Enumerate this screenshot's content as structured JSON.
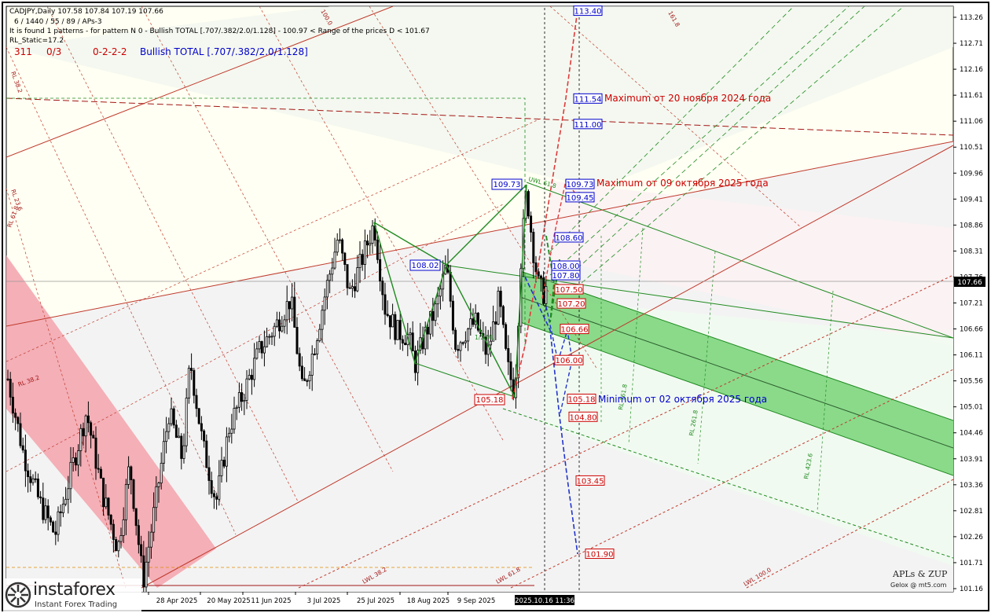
{
  "header": {
    "symbol_line": "CADJPY,Daily  107.58 107.84 107.19 107.66",
    "params_line": "6 / 1440 / 55 / 89 / APs-3",
    "found_line": "It is found 1 patterns  -  for pattern N 0 - Bullish TOTAL [.707/.382/2.0/1.128] - 100.97 < Range of the prices D < 101.67",
    "static_line": "RL_Static=17.2",
    "count_a": "311",
    "count_b": "0/3",
    "code": "0-2-2-2",
    "pattern_name": "Bullish TOTAL [.707/.382/2.0/1.128]"
  },
  "colors": {
    "red": "#cc0000",
    "blue": "#0000cc",
    "green": "#1f8a1f",
    "band_green": "#7ed67e",
    "band_pink": "#f4a7b0",
    "price_line": "#999999"
  },
  "chart_data": {
    "type": "candlestick",
    "symbol": "CADJPY",
    "timeframe": "Daily",
    "ohlc_last": {
      "open": 107.58,
      "high": 107.84,
      "low": 107.19,
      "close": 107.66
    },
    "current_price": 107.66,
    "y_ticks": [
      113.26,
      112.71,
      112.16,
      111.61,
      111.06,
      110.51,
      109.96,
      109.41,
      108.86,
      108.31,
      107.76,
      107.21,
      106.66,
      106.11,
      105.56,
      105.01,
      104.46,
      103.91,
      103.36,
      102.81,
      102.26,
      101.71,
      101.16
    ],
    "ylim": [
      101.05,
      113.5
    ],
    "x_ticks": [
      "28 Apr 2025",
      "20 May 2025",
      "11 Jun 2025",
      "3 Jul 2025",
      "25 Jul 2025",
      "18 Aug 2025",
      "9 Sep 2025"
    ],
    "cursor_time": "2025.10.16 11:36",
    "pattern_points": [
      {
        "label": "108.02",
        "price": 108.02
      },
      {
        "label": "109.73",
        "price": 109.73
      },
      {
        "label": "105.18",
        "price": 105.18
      }
    ],
    "targets": [
      {
        "label": "113.40",
        "price": 113.4,
        "color": "blue"
      },
      {
        "label": "111.54",
        "price": 111.54,
        "color": "blue"
      },
      {
        "label": "111.00",
        "price": 111.0,
        "color": "blue"
      },
      {
        "label": "109.73",
        "price": 109.73,
        "color": "blue"
      },
      {
        "label": "109.45",
        "price": 109.45,
        "color": "blue"
      },
      {
        "label": "108.60",
        "price": 108.6,
        "color": "blue"
      },
      {
        "label": "108.00",
        "price": 108.0,
        "color": "blue"
      },
      {
        "label": "107.80",
        "price": 107.8,
        "color": "blue"
      },
      {
        "label": "107.50",
        "price": 107.5,
        "color": "red"
      },
      {
        "label": "107.20",
        "price": 107.2,
        "color": "red"
      },
      {
        "label": "106.66",
        "price": 106.66,
        "color": "red"
      },
      {
        "label": "106.00",
        "price": 106.0,
        "color": "red"
      },
      {
        "label": "105.18",
        "price": 105.18,
        "color": "red"
      },
      {
        "label": "104.80",
        "price": 104.8,
        "color": "red"
      },
      {
        "label": "103.45",
        "price": 103.45,
        "color": "red"
      },
      {
        "label": "101.90",
        "price": 101.9,
        "color": "red"
      }
    ],
    "annotations": [
      {
        "text": "Maximum от 20 ноября 2024 года",
        "price": 111.54,
        "color": "red"
      },
      {
        "text": "Maximum от 09 октября 2025 года",
        "price": 109.73,
        "color": "red"
      },
      {
        "text": "Minimum от 02 октября 2025 года",
        "price": 105.18,
        "color": "blue"
      }
    ],
    "level_labels": [
      "100.0",
      "161.8",
      "RL 38.2",
      "RL 23.6",
      "RL 61.8",
      "RL 38.2",
      "UWL 61.8",
      "1/2 ML",
      "RL 161.8",
      "RL 261.8",
      "RL 423.6",
      "LWL 38.2",
      "LWL 61.8",
      "LWL 100.0"
    ]
  },
  "footer": {
    "brand": "instaforex",
    "tagline": "Instant Forex Trading",
    "apls": "APLs & ZUP",
    "gelox": "Gelox @ mt5.com"
  }
}
